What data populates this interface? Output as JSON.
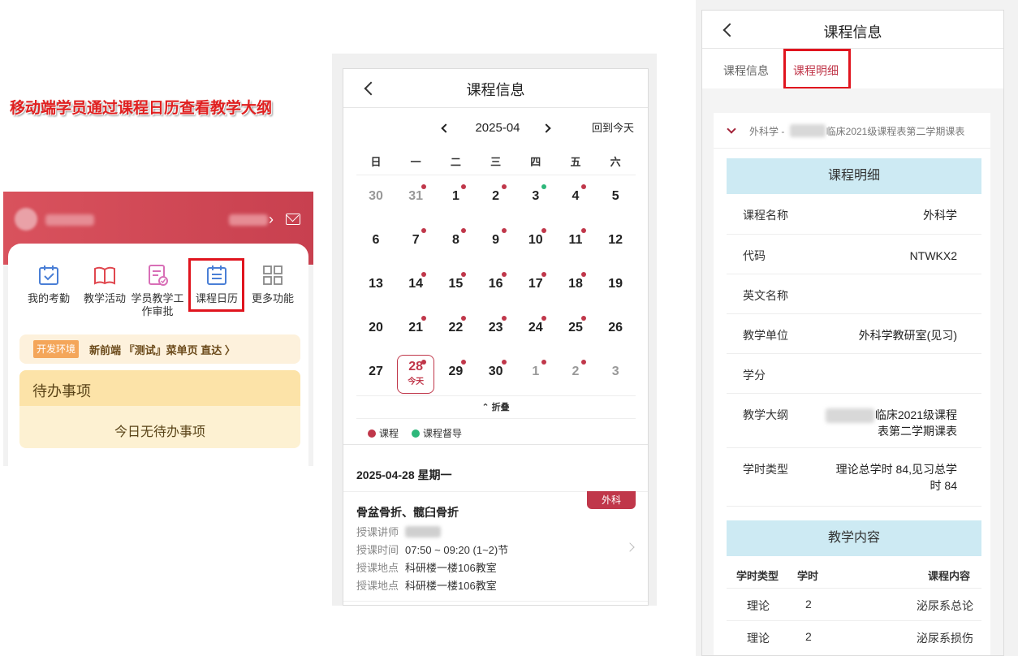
{
  "annotation": "移动端学员通过课程日历查看教学大纲",
  "home": {
    "functions": [
      {
        "label": "我的考勤",
        "icon": "attendance-icon"
      },
      {
        "label": "教学活动",
        "icon": "book-icon"
      },
      {
        "label": "学员教学工作审批",
        "icon": "approval-icon"
      },
      {
        "label": "课程日历",
        "icon": "calendar-icon"
      },
      {
        "label": "更多功能",
        "icon": "grid-icon"
      }
    ],
    "notice_tag": "开发环境",
    "notice_text": "新前端 『测试』菜单页 直达 〉",
    "todo_title": "待办事项",
    "todo_empty": "今日无待办事项"
  },
  "calendar_page": {
    "title": "课程信息",
    "month": "2025-04",
    "back_to_today": "回到今天",
    "weekdays": [
      "日",
      "一",
      "二",
      "三",
      "四",
      "五",
      "六"
    ],
    "days": [
      {
        "d": "30",
        "gray": true,
        "dot": ""
      },
      {
        "d": "31",
        "gray": true,
        "dot": "red"
      },
      {
        "d": "1",
        "dot": "red"
      },
      {
        "d": "2",
        "dot": "red"
      },
      {
        "d": "3",
        "dot": "green"
      },
      {
        "d": "4",
        "dot": "red"
      },
      {
        "d": "5",
        "dot": ""
      },
      {
        "d": "6",
        "dot": ""
      },
      {
        "d": "7",
        "dot": "red"
      },
      {
        "d": "8",
        "dot": "red"
      },
      {
        "d": "9",
        "dot": "red"
      },
      {
        "d": "10",
        "dot": "red"
      },
      {
        "d": "11",
        "dot": "red"
      },
      {
        "d": "12",
        "dot": ""
      },
      {
        "d": "13",
        "dot": ""
      },
      {
        "d": "14",
        "dot": "red"
      },
      {
        "d": "15",
        "dot": "red"
      },
      {
        "d": "16",
        "dot": "red"
      },
      {
        "d": "17",
        "dot": "red"
      },
      {
        "d": "18",
        "dot": "red"
      },
      {
        "d": "19",
        "dot": ""
      },
      {
        "d": "20",
        "dot": ""
      },
      {
        "d": "21",
        "dot": "red"
      },
      {
        "d": "22",
        "dot": "red"
      },
      {
        "d": "23",
        "dot": "red"
      },
      {
        "d": "24",
        "dot": "red"
      },
      {
        "d": "25",
        "dot": "red"
      },
      {
        "d": "26",
        "dot": ""
      },
      {
        "d": "27",
        "dot": ""
      },
      {
        "d": "28",
        "dot": "red",
        "selected": true
      },
      {
        "d": "29",
        "dot": "red"
      },
      {
        "d": "30",
        "dot": "red"
      },
      {
        "d": "1",
        "gray": true,
        "dot": "red"
      },
      {
        "d": "2",
        "gray": true,
        "dot": "red"
      },
      {
        "d": "3",
        "gray": true,
        "dot": ""
      }
    ],
    "today_label": "今天",
    "fold": "⌃ 折叠",
    "legend": [
      {
        "label": "课程",
        "color": "#c0374a"
      },
      {
        "label": "课程督导",
        "color": "#2db77a"
      }
    ],
    "date_heading": "2025-04-28 星期一",
    "badge": "外科",
    "course_title": "骨盆骨折、髋臼骨折",
    "rows": [
      {
        "k": "授课讲师",
        "v": ""
      },
      {
        "k": "授课时间",
        "v": "07:50 ~ 09:20 (1~2)节"
      },
      {
        "k": "授课地点",
        "v": "科研楼一楼106教室"
      },
      {
        "k": "授课地点",
        "v": "科研楼一楼106教室"
      }
    ]
  },
  "detail_page": {
    "title": "课程信息",
    "tabs": [
      "课程信息",
      "课程明细"
    ],
    "semester": "外科学 - 　　　　临床2021级课程表第二学期课表",
    "section1": "课程明细",
    "fields": [
      {
        "k": "课程名称",
        "v": "外科学"
      },
      {
        "k": "代码",
        "v": "NTWKX2"
      },
      {
        "k": "英文名称",
        "v": ""
      },
      {
        "k": "教学单位",
        "v": "外科学教研室(见习)"
      },
      {
        "k": "学分",
        "v": ""
      },
      {
        "k": "教学大纲",
        "v1": "临床2021级课程",
        "v2": "表第二学期课表"
      },
      {
        "k": "学时类型",
        "v1": "理论总学时 84,见习总学",
        "v2": "时 84"
      }
    ],
    "section2": "教学内容",
    "table_headers": [
      "学时类型",
      "学时",
      "课程内容"
    ],
    "table_rows": [
      [
        "理论",
        "2",
        "泌尿系总论"
      ],
      [
        "理论",
        "2",
        "泌尿系损伤"
      ]
    ]
  }
}
